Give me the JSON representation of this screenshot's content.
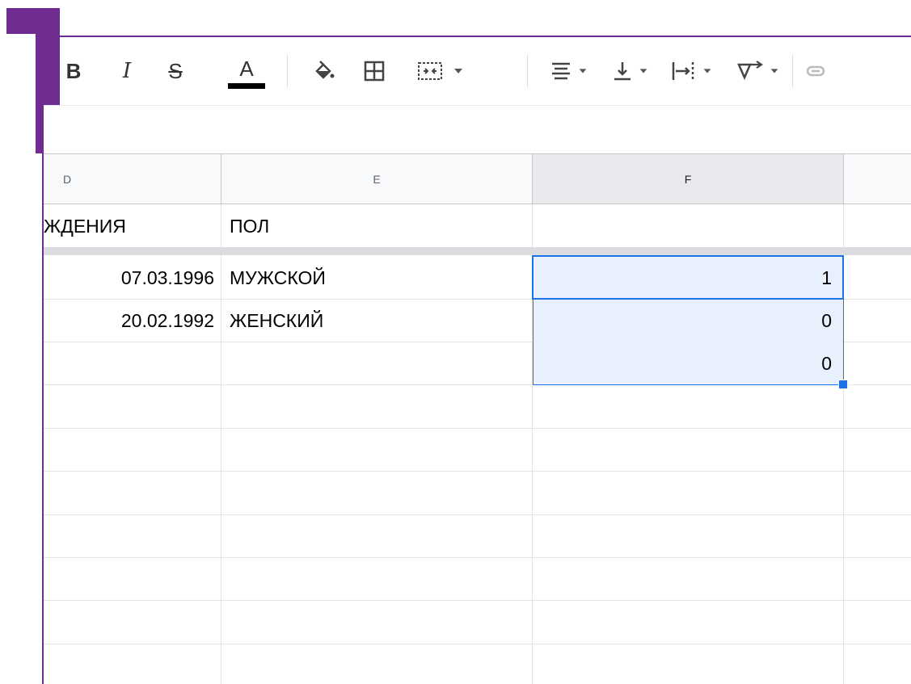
{
  "toolbar": {
    "items": [
      {
        "name": "bold-button",
        "label": "B"
      },
      {
        "name": "italic-button",
        "label": "I"
      },
      {
        "name": "strikethrough-button",
        "label": "S"
      },
      {
        "name": "text-color-button",
        "label": "A"
      }
    ]
  },
  "columns": [
    "D",
    "E",
    "F"
  ],
  "selected_column": "F",
  "header_row": {
    "D": "ЖДЕНИЯ",
    "E": "ПОЛ",
    "F": ""
  },
  "rows": [
    {
      "D": "07.03.1996",
      "E": "МУЖСКОЙ",
      "F": "1"
    },
    {
      "D": "20.02.1992",
      "E": "ЖЕНСКИЙ",
      "F": "0"
    },
    {
      "D": "",
      "E": "",
      "F": "0"
    }
  ],
  "colors": {
    "frame_accent": "#6f2d91",
    "selection": "#1a73e8",
    "selection_fill": "#e8f0fe"
  }
}
